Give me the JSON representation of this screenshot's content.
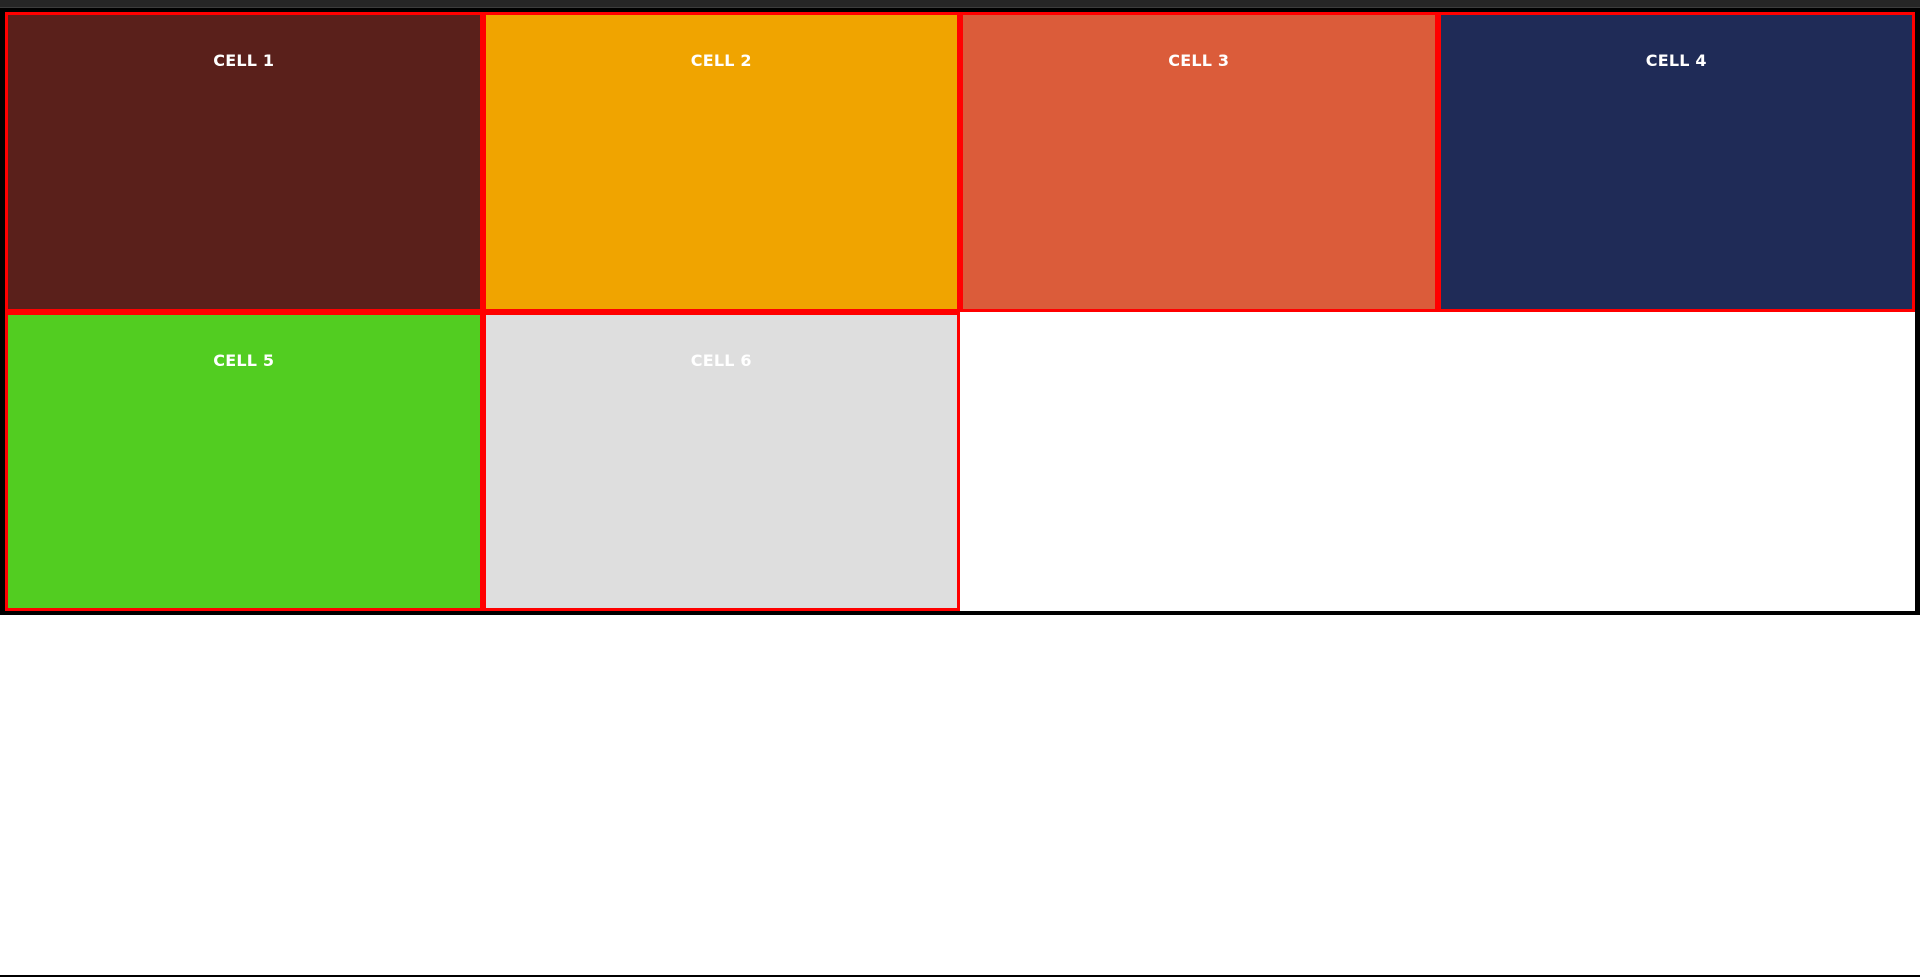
{
  "cells": [
    {
      "label": "CELL 1",
      "bg": "#5a201b"
    },
    {
      "label": "CELL 2",
      "bg": "#f0a400"
    },
    {
      "label": "CELL 3",
      "bg": "#db5c3a"
    },
    {
      "label": "CELL 4",
      "bg": "#1f2b57"
    },
    {
      "label": "CELL 5",
      "bg": "#52cd21"
    },
    {
      "label": "CELL 6",
      "bg": "#dedede"
    }
  ],
  "colors": {
    "border": "#ff0000",
    "frame": "#000000",
    "label_text": "#ffffff",
    "empty_area": "#ffffff"
  }
}
